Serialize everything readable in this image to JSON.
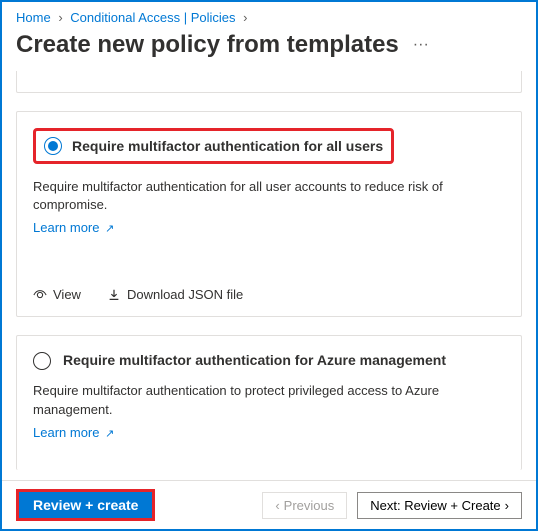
{
  "breadcrumb": {
    "home": "Home",
    "section": "Conditional Access | Policies"
  },
  "page": {
    "title": "Create new policy from templates"
  },
  "card1": {
    "title": "Require multifactor authentication for all users",
    "desc": "Require multifactor authentication for all user accounts to reduce risk of compromise.",
    "learn": "Learn more",
    "view": "View",
    "download": "Download JSON file"
  },
  "card2": {
    "title": "Require multifactor authentication for Azure management",
    "desc": "Require multifactor authentication to protect privileged access to Azure management.",
    "learn": "Learn more"
  },
  "footer": {
    "primary": "Review + create",
    "prev": "Previous",
    "next": "Next: Review + Create"
  }
}
